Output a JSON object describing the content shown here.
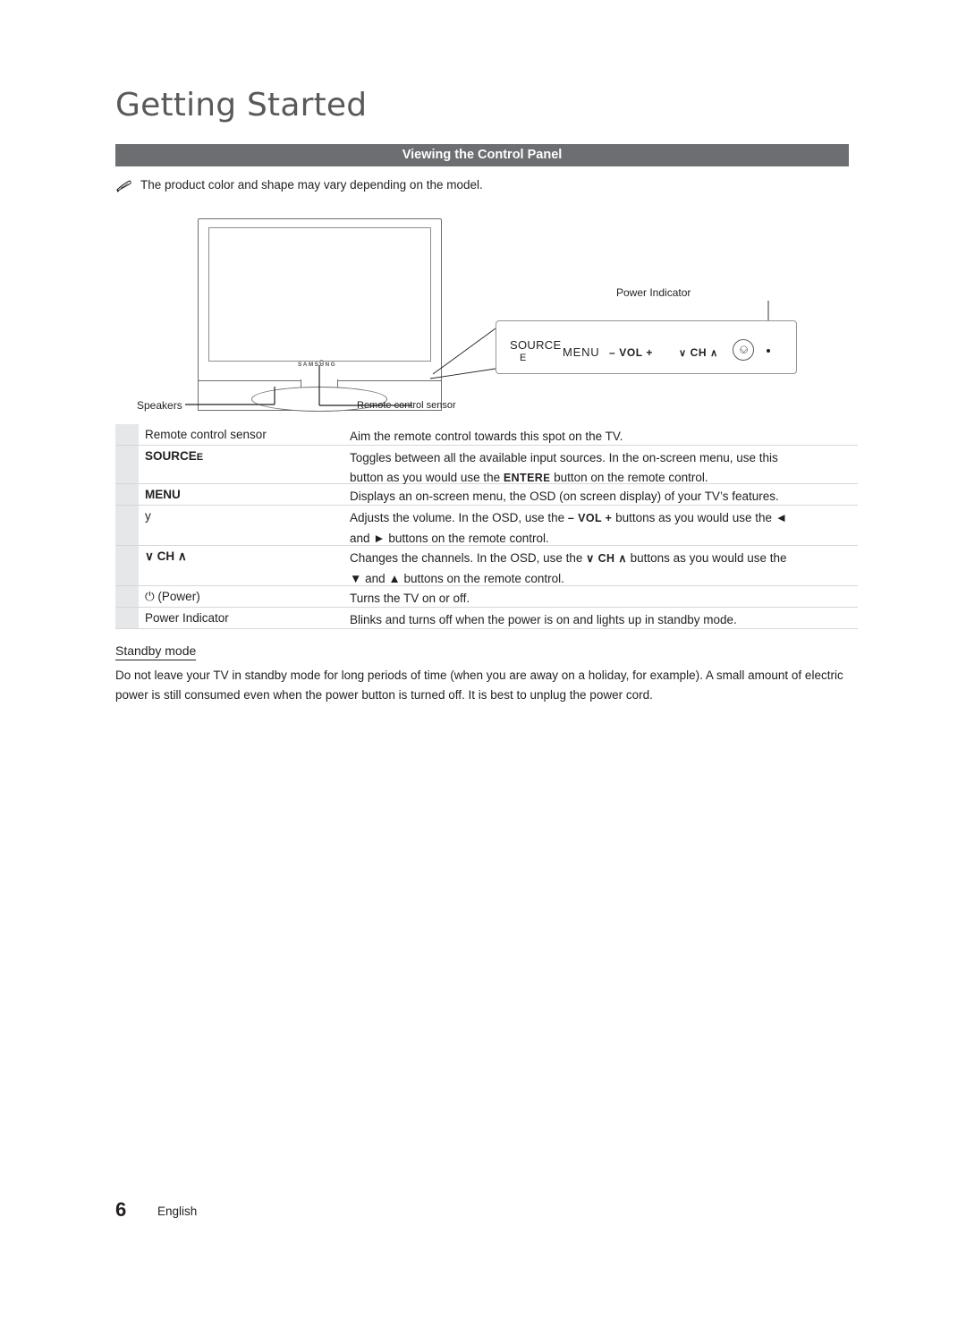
{
  "document": {
    "chapter_title": "Getting Started",
    "section_header": "Viewing the Control Panel",
    "note": "The product color and shape may vary depending on the model.",
    "note_icon": "pencil-note-icon"
  },
  "illustration": {
    "tv_brand": "SAMSUNG",
    "callouts": {
      "power_indicator": "Power Indicator",
      "speakers": "Speakers",
      "remote_control_sensor": "Remote control sensor"
    },
    "panel_buttons": {
      "source": "SOURCE",
      "source_sub": "E",
      "menu": "MENU",
      "vol_minus": "–",
      "vol": "VOL",
      "vol_plus": "+",
      "ch_down": "∨",
      "ch": "CH",
      "ch_up": "∧",
      "power": "power-icon",
      "indicator_dot": "indicator-dot"
    }
  },
  "table": {
    "rows": [
      {
        "label": "Remote control sensor",
        "label_style": "plain",
        "desc": "Aim the remote control towards this spot on the TV."
      },
      {
        "label": "SOURCE",
        "label_suffix": "E",
        "label_style": "bold",
        "desc_line1": "Toggles between all the available input sources. In the on-screen menu, use this",
        "desc_line2_pre": "button as you would use the ",
        "desc_line2_key": "ENTER",
        "desc_line2_key_suffix": "E",
        "desc_line2_post": " button on the remote control."
      },
      {
        "label": "MENU",
        "label_style": "bold",
        "desc": "Displays an on-screen menu, the OSD (on screen display) of your TV’s features."
      },
      {
        "label": "y",
        "label_style": "plain",
        "desc_line1_pre": "Adjusts the volume. In the OSD, use the ",
        "desc_line1_key": "– VOL +",
        "desc_line1_post": " buttons as you would use the ◄",
        "desc_line2": "and ► buttons on the remote control."
      },
      {
        "label": "∨ CH ∧",
        "label_style": "bold",
        "desc_line1_pre": "Changes the channels. In the OSD, use the ",
        "desc_line1_key": "∨ CH ∧",
        "desc_line1_post": " buttons as you would use the",
        "desc_line2": "▼ and ▲ buttons on the remote control."
      },
      {
        "label": "⏻ (Power)",
        "label_style": "plain",
        "desc": "Turns the TV on or off."
      },
      {
        "label": "Power Indicator",
        "label_style": "plain",
        "desc": "Blinks and turns off when the power is on and lights up in standby mode."
      }
    ]
  },
  "standby": {
    "heading": "Standby mode",
    "body_line1": "Do not leave your TV in standby mode for long periods of time (when you are away on a holiday, for example). A small amount",
    "body_line2": "of electric power is still consumed even when the power button is turned off. It is best to unplug the power cord."
  },
  "footer": {
    "page_number": "6",
    "language": "English"
  }
}
